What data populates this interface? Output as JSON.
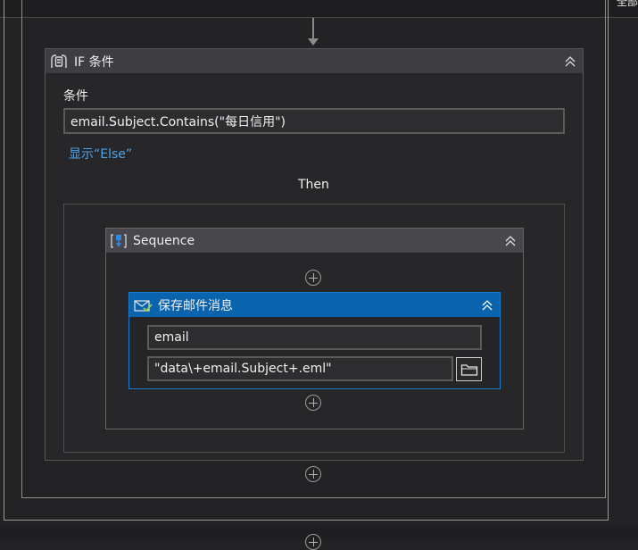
{
  "corner": {
    "text": "全部"
  },
  "if_activity": {
    "title": "IF 条件",
    "condition_label": "条件",
    "condition_value": "email.Subject.Contains(\"每日信用\")",
    "show_else_link": "显示“Else”",
    "then_label": "Then"
  },
  "sequence": {
    "title": "Sequence"
  },
  "save_mail": {
    "title": "保存邮件消息",
    "mail_value": "email",
    "path_value": "\"data\\+email.Subject+.eml\""
  },
  "colors": {
    "background": "#232325",
    "header": "#3e3e42",
    "selected_header": "#0a64ad",
    "link": "#4aa3e8"
  }
}
